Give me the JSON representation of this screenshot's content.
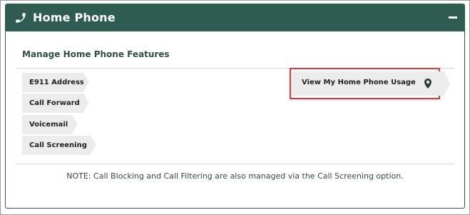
{
  "panel": {
    "title": "Home Phone",
    "header_icon": "phone-icon",
    "collapse_icon": "minus-icon",
    "header_color": "#2f5c51"
  },
  "section": {
    "title": "Manage Home Phone Features"
  },
  "features": [
    {
      "label": "E911 Address"
    },
    {
      "label": "Call Forward"
    },
    {
      "label": "Voicemail"
    },
    {
      "label": "Call Screening"
    }
  ],
  "usage": {
    "label": "View My Home Phone Usage",
    "icon": "map-pin-icon",
    "highlight_color": "#e0383f"
  },
  "note": "NOTE: Call Blocking and Call Filtering are also managed via the Call Screening option."
}
